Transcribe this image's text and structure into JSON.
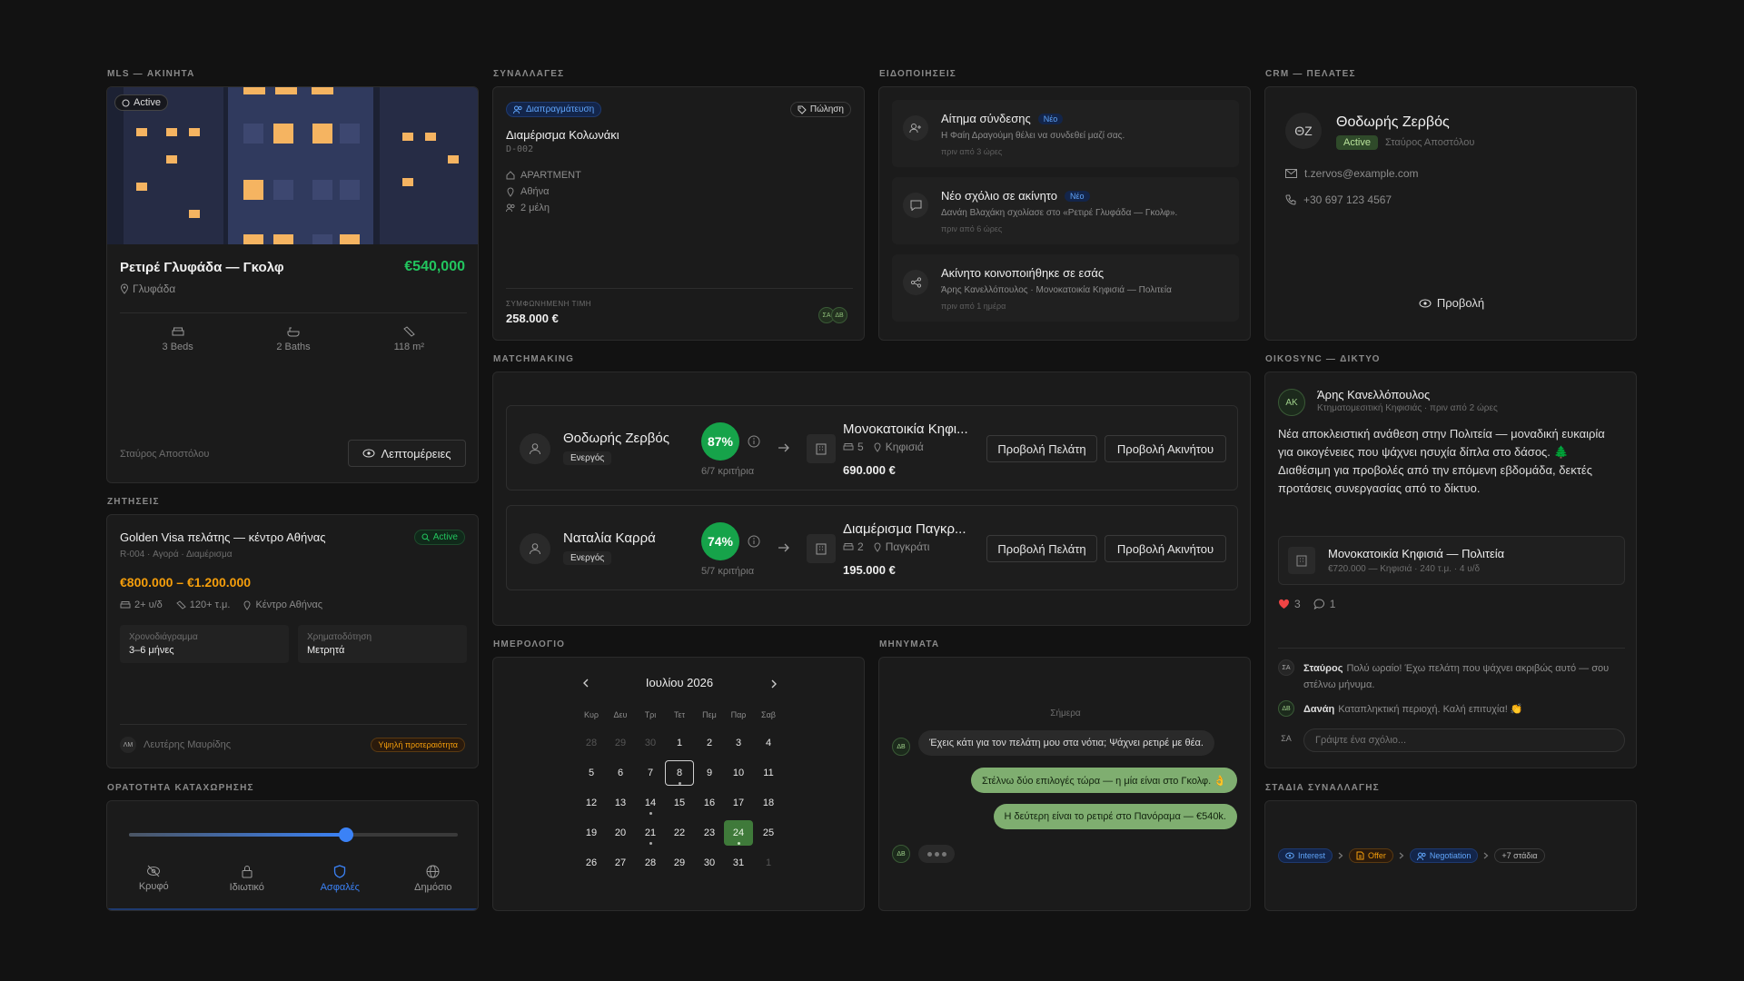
{
  "sections": {
    "mls": "MLS — ΑΚΙΝΗΤΑ",
    "deals": "ΣΥΝΑΛΛΑΓΕΣ",
    "notifications": "ΕΙΔΟΠΟΙΗΣΕΙΣ",
    "crm": "CRM — ΠΕΛΑΤΕΣ",
    "matchmaking": "MATCHMAKING",
    "network": "OIKOSYNC — ΔΙΚΤΥΟ",
    "demands": "ΖΗΤΗΣΕΙΣ",
    "calendar": "ΗΜΕΡΟΛΟΓΙΟ",
    "messages": "ΜΗΝΥΜΑΤΑ",
    "visibility": "ΟΡΑΤΟΤΗΤΑ ΚΑΤΑΧΩΡΗΣΗΣ",
    "stages": "ΣΤΑΔΙΑ ΣΥΝΑΛΛΑΓΗΣ"
  },
  "listing": {
    "status": "Active",
    "title": "Ρετιρέ Γλυφάδα — Γκολφ",
    "price": "€540,000",
    "location": "Γλυφάδα",
    "beds": "3 Beds",
    "baths": "2 Baths",
    "area": "118 m²",
    "agent": "Σταύρος Αποστόλου",
    "details_button": "Λεπτομέρειες"
  },
  "deal": {
    "badge": "Διαπραγμάτευση",
    "type": "Πώληση",
    "title": "Διαμέρισμα Κολωνάκι",
    "code": "D-002",
    "property_type": "APARTMENT",
    "city": "Αθήνα",
    "members": "2 μέλη",
    "price_label": "ΣΥΜΦΩΝΗΜΕΝΗ ΤΙΜΗ",
    "price": "258.000 €",
    "avatars": [
      "ΣΑ",
      "ΔΒ"
    ]
  },
  "notifications": [
    {
      "title": "Αίτημα σύνδεσης",
      "badge": "Νέο",
      "text": "Η Φαίη Δραγούμη θέλει να συνδεθεί μαζί σας.",
      "time": "πριν από 3 ώρες",
      "icon": "user-plus-icon"
    },
    {
      "title": "Νέο σχόλιο σε ακίνητο",
      "badge": "Νέο",
      "text": "Δανάη Βλαχάκη σχολίασε στο «Ρετιρέ Γλυφάδα — Γκολφ».",
      "time": "πριν από 6 ώρες",
      "icon": "comment-icon"
    },
    {
      "title": "Ακίνητο κοινοποιήθηκε σε εσάς",
      "badge": "",
      "text": "Άρης Κανελλόπουλος · Μονοκατοικία Κηφισιά — Πολιτεία",
      "time": "πριν από 1 ημέρα",
      "icon": "share-icon"
    }
  ],
  "crm": {
    "initials": "ΘΖ",
    "name": "Θοδωρής Ζερβός",
    "status": "Active",
    "agent": "Σταύρος Αποστόλου",
    "email": "t.zervos@example.com",
    "phone": "+30 697 123 4567",
    "view_button": "Προβολή"
  },
  "matches": [
    {
      "client": "Θοδωρής Ζερβός",
      "status": "Ενεργός",
      "score": "87%",
      "criteria": "6/7 κριτήρια",
      "property": "Μονοκατοικία Κηφι...",
      "rooms": "5",
      "location": "Κηφισιά",
      "price": "690.000 €",
      "btn_client": "Προβολή Πελάτη",
      "btn_property": "Προβολή Ακινήτου"
    },
    {
      "client": "Ναταλία Καρρά",
      "status": "Ενεργός",
      "score": "74%",
      "criteria": "5/7 κριτήρια",
      "property": "Διαμέρισμα Παγκρ...",
      "rooms": "2",
      "location": "Παγκράτι",
      "price": "195.000 €",
      "btn_client": "Προβολή Πελάτη",
      "btn_property": "Προβολή Ακινήτου"
    }
  ],
  "network": {
    "initials": "ΑΚ",
    "author": "Άρης Κανελλόπουλος",
    "meta": "Κτηματομεσιτική Κηφισιάς · πριν από 2 ώρες",
    "post": "Νέα αποκλειστική ανάθεση στην Πολιτεία — μοναδική ευκαιρία για οικογένειες που ψάχνει ησυχία δίπλα στο δάσος. 🌲 Διαθέσιμη για προβολές από την επόμενη εβδομάδα, δεκτές προτάσεις συνεργασίας από το δίκτυο.",
    "attachment_title": "Μονοκατοικία Κηφισιά — Πολιτεία",
    "attachment_meta": "€720.000 — Κηφισιά · 240 τ.μ. · 4 υ/δ",
    "likes": "3",
    "comments_count": "1",
    "comments": [
      {
        "initials": "ΣΑ",
        "author": "Σταύρος",
        "text": "Πολύ ωραίο! Έχω πελάτη που ψάχνει ακριβώς αυτό — σου στέλνω μήνυμα."
      },
      {
        "initials": "ΔΒ",
        "author": "Δανάη",
        "text": "Καταπληκτική περιοχή. Καλή επιτυχία! 👏"
      }
    ],
    "composer_initials": "ΣΑ",
    "comment_placeholder": "Γράψτε ένα σχόλιο..."
  },
  "demand": {
    "title": "Golden Visa πελάτης — κέντρο Αθήνας",
    "status": "Active",
    "meta": "R-004 · Αγορά · Διαμέρισμα",
    "budget": "€800.000 – €1.200.000",
    "rooms": "2+ υ/δ",
    "size": "120+ τ.μ.",
    "area": "Κέντρο Αθήνας",
    "timeline_label": "Χρονοδιάγραμμα",
    "timeline": "3–6 μήνες",
    "financing_label": "Χρηματοδότηση",
    "financing": "Μετρητά",
    "agent_initials": "ΛΜ",
    "agent": "Λευτέρης Μαυρίδης",
    "priority": "Υψηλή προτεραιότητα"
  },
  "calendar": {
    "month": "Ιουλίου 2026",
    "weekdays": [
      "Κυρ",
      "Δευ",
      "Τρι",
      "Τετ",
      "Πεμ",
      "Παρ",
      "Σαβ"
    ],
    "weeks": [
      [
        "28",
        "29",
        "30",
        "1",
        "2",
        "3",
        "4"
      ],
      [
        "5",
        "6",
        "7",
        "8",
        "9",
        "10",
        "11"
      ],
      [
        "12",
        "13",
        "14",
        "15",
        "16",
        "17",
        "18"
      ],
      [
        "19",
        "20",
        "21",
        "22",
        "23",
        "24",
        "25"
      ],
      [
        "26",
        "27",
        "28",
        "29",
        "30",
        "31",
        "1"
      ]
    ]
  },
  "messages": {
    "day": "Σήμερα",
    "items": [
      {
        "side": "in",
        "initials": "ΔΒ",
        "text": "Έχεις κάτι για τον πελάτη μου στα νότια; Ψάχνει ρετιρέ με θέα."
      },
      {
        "side": "out",
        "text": "Στέλνω δύο επιλογές τώρα — η μία είναι στο Γκολφ. 👌"
      },
      {
        "side": "out",
        "text": "Η δεύτερη είναι το ρετιρέ στο Πανόραμα — €540k."
      }
    ],
    "typing_initials": "ΔΒ"
  },
  "visibility": {
    "level": 0.66,
    "options": [
      {
        "label": "Κρυφό",
        "icon": "eye-off-icon"
      },
      {
        "label": "Ιδιωτικό",
        "icon": "lock-icon"
      },
      {
        "label": "Ασφαλές",
        "icon": "shield-icon"
      },
      {
        "label": "Δημόσιο",
        "icon": "globe-icon"
      }
    ],
    "selected": "Ασφαλές"
  },
  "stages": {
    "items": [
      {
        "label": "Interest",
        "icon": "eye-icon"
      },
      {
        "label": "Offer",
        "icon": "document-icon"
      },
      {
        "label": "Negotiation",
        "icon": "users-icon"
      }
    ],
    "more": "+7 στάδια"
  },
  "colors": {
    "accent_green": "#22c55e",
    "accent_blue": "#3b82f6",
    "accent_orange": "#f59e0b",
    "background": "#121212"
  }
}
